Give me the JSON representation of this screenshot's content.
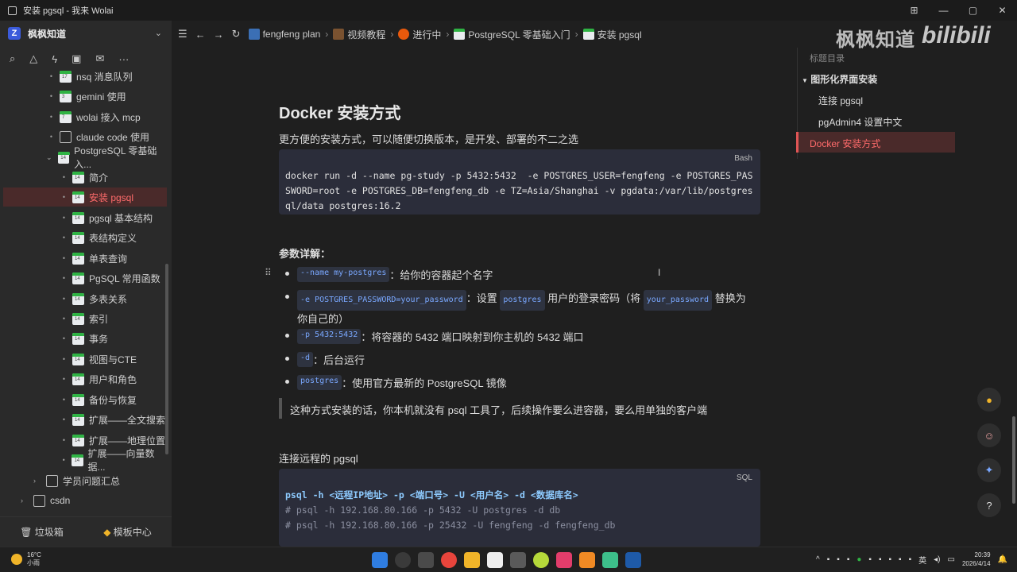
{
  "window": {
    "title": "安装 pgsql - 我来 Wolai"
  },
  "workspace": {
    "name": "枫枫知道"
  },
  "sidebar": {
    "items": [
      {
        "label": "nsq 消息队列",
        "num": "17"
      },
      {
        "label": "gemini 使用",
        "num": "3"
      },
      {
        "label": "wolai 接入 mcp",
        "num": "7"
      },
      {
        "label": "claude code 使用",
        "num": ""
      },
      {
        "label": "PostgreSQL 零基础入...",
        "num": "14"
      },
      {
        "label": "简介",
        "num": "14"
      },
      {
        "label": "安装 pgsql",
        "num": "14"
      },
      {
        "label": "pgsql 基本结构",
        "num": "14"
      },
      {
        "label": "表结构定义",
        "num": "14"
      },
      {
        "label": "单表查询",
        "num": "14"
      },
      {
        "label": "PgSQL 常用函数",
        "num": "14"
      },
      {
        "label": "多表关系",
        "num": "14"
      },
      {
        "label": "索引",
        "num": "14"
      },
      {
        "label": "事务",
        "num": "14"
      },
      {
        "label": "视图与CTE",
        "num": "14"
      },
      {
        "label": "用户和角色",
        "num": "14"
      },
      {
        "label": "备份与恢复",
        "num": "14"
      },
      {
        "label": "扩展——全文搜索",
        "num": "14"
      },
      {
        "label": "扩展——地理位置",
        "num": "14"
      },
      {
        "label": "扩展——向量数据...",
        "num": "14"
      },
      {
        "label": "学员问题汇总",
        "num": ""
      },
      {
        "label": "csdn",
        "num": ""
      }
    ],
    "footer": {
      "trash": "垃圾箱",
      "templates": "模板中心"
    }
  },
  "breadcrumb": [
    "fengfeng plan",
    "视频教程",
    "进行中",
    "PostgreSQL 零基础入门",
    "安装 pgsql"
  ],
  "watermark": {
    "text": "枫枫知道",
    "logo": "bilibili"
  },
  "doc": {
    "heading": "Docker 安装方式",
    "intro": "更方便的安装方式，可以随便切换版本，是开发、部署的不二之选",
    "code1": {
      "lang": "Bash",
      "text": "docker run -d --name pg-study -p 5432:5432  -e POSTGRES_USER=fengfeng -e POSTGRES_PASSWORD=root -e POSTGRES_DB=fengfeng_db -e TZ=Asia/Shanghai -v pgdata:/var/lib/postgresql/data postgres:16.2"
    },
    "params_title": "参数详解：",
    "bullets": [
      {
        "code": "--name my-postgres",
        "text": "：给你的容器起个名字"
      },
      {
        "code": "-e POSTGRES_PASSWORD=your_password",
        "text": "：设置",
        "code2": "postgres",
        "text2": "用户的登录密码（将",
        "code3": "your_password",
        "text3": "替换为",
        "text4": "你自己的）"
      },
      {
        "code": "-p 5432:5432",
        "text": "：将容器的 5432 端口映射到你主机的 5432 端口"
      },
      {
        "code": "-d",
        "text": "：后台运行"
      },
      {
        "code": "postgres",
        "text": "：使用官方最新的 PostgreSQL 镜像"
      }
    ],
    "quote": "这种方式安装的话，你本机就没有 psql 工具了，后续操作要么进容器，要么用单独的客户端",
    "remote_title": "连接远程的 pgsql",
    "code2": {
      "lang": "SQL",
      "line1": "psql -h <远程IP地址> -p <端口号> -U <用户名> -d <数据库名>",
      "line2": "# psql -h 192.168.80.166 -p 5432 -U postgres -d db",
      "line3": "# psql -h 192.168.80.166 -p 25432 -U fengfeng -d fengfeng_db"
    }
  },
  "toc": {
    "header": "标题目录",
    "items": [
      "图形化界面安装",
      "连接 pgsql",
      "pgAdmin4 设置中文",
      "Docker 安装方式"
    ],
    "active": "Docker 安装方式"
  },
  "taskbar": {
    "weather_temp": "16°C",
    "weather_desc": "小雨",
    "time": "20:39",
    "date": "2026/4/14",
    "lang": "英"
  }
}
